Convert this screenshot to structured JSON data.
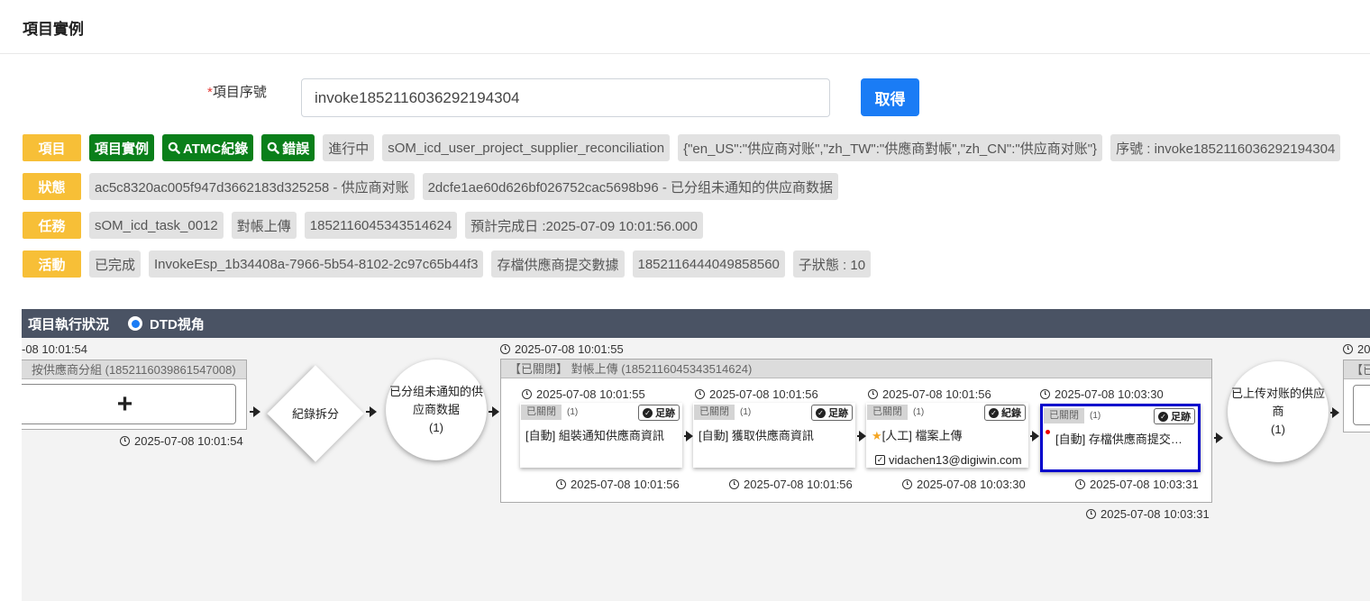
{
  "page": {
    "title": "項目實例"
  },
  "form": {
    "required_mark": "*",
    "serial_label": "項目序號",
    "serial_value": "invoke1852116036292194304",
    "fetch_label": "取得"
  },
  "info": {
    "project": {
      "label": "項目",
      "btn_instance": "項目實例",
      "btn_atmc": "ATMC紀錄",
      "btn_error": "錯誤",
      "chips": [
        "進行中",
        "sOM_icd_user_project_supplier_reconciliation",
        "{\"en_US\":\"供应商对账\",\"zh_TW\":\"供應商對帳\",\"zh_CN\":\"供应商对账\"}",
        "序號 : invoke1852116036292194304"
      ]
    },
    "status": {
      "label": "狀態",
      "chips": [
        "ac5c8320ac005f947d3662183d325258 - 供应商对账",
        "2dcfe1ae60d626bf026752cac5698b96 - 已分组未通知的供应商数据"
      ]
    },
    "task": {
      "label": "任務",
      "chips": [
        "sOM_icd_task_0012",
        "對帳上傳",
        "1852116045343514624",
        "預計完成日 :2025-07-09 10:01:56.000"
      ]
    },
    "activity": {
      "label": "活動",
      "chips": [
        "已完成",
        "InvokeEsp_1b34408a-7966-5b54-8102-2c97c65b44f3",
        "存檔供應商提交數據",
        "1852116444049858560",
        "子狀態 : 10"
      ]
    }
  },
  "dtd": {
    "title": "項目執行狀況",
    "radio_label": "DTD視角",
    "flow": {
      "left_ts_top": "-08 10:01:54",
      "left_group_title": "按供應商分組 (1852116039861547008)",
      "left_plus": "+",
      "left_ts_bottom": "2025-07-08 10:01:54",
      "diamond_label": "紀錄拆分",
      "circle1_label": "已分组未通知的供应商数据",
      "circle1_count": "(1)",
      "group_ts_top": "2025-07-08 10:01:55",
      "group_title": "【已關閉】 對帳上傳 (1852116045343514624)",
      "group_ts_bottom": "2025-07-08 10:03:31",
      "closed_tag": "已關閉",
      "count": "(1)",
      "trace_label": "足跡",
      "record_label": "紀錄",
      "cards": [
        {
          "ts_top": "2025-07-08 10:01:55",
          "title": "[自動] 組裝通知供應商資訊",
          "ts_bottom": "2025-07-08 10:01:56"
        },
        {
          "ts_top": "2025-07-08 10:01:56",
          "title": "[自動] 獲取供應商資訊",
          "ts_bottom": "2025-07-08 10:01:56"
        },
        {
          "ts_top": "2025-07-08 10:01:56",
          "title": "[人工] 檔案上傳",
          "user": "vidachen13@digiwin.com",
          "ts_bottom": "2025-07-08 10:03:30"
        },
        {
          "ts_top": "2025-07-08 10:03:30",
          "title": "[自動] 存檔供應商提交數據",
          "ts_bottom": "2025-07-08 10:03:31"
        }
      ],
      "circle2_label": "已上传对账的供应商",
      "circle2_count": "(1)",
      "right_ts_top": "20",
      "right_group_title": "【已"
    }
  },
  "colors": {
    "accent_blue": "#1a7cf5",
    "badge_yellow": "#f7bf37",
    "btn_green": "#0a7f1a",
    "bar_dark": "#4a5364",
    "selected_border": "#0000cc"
  }
}
